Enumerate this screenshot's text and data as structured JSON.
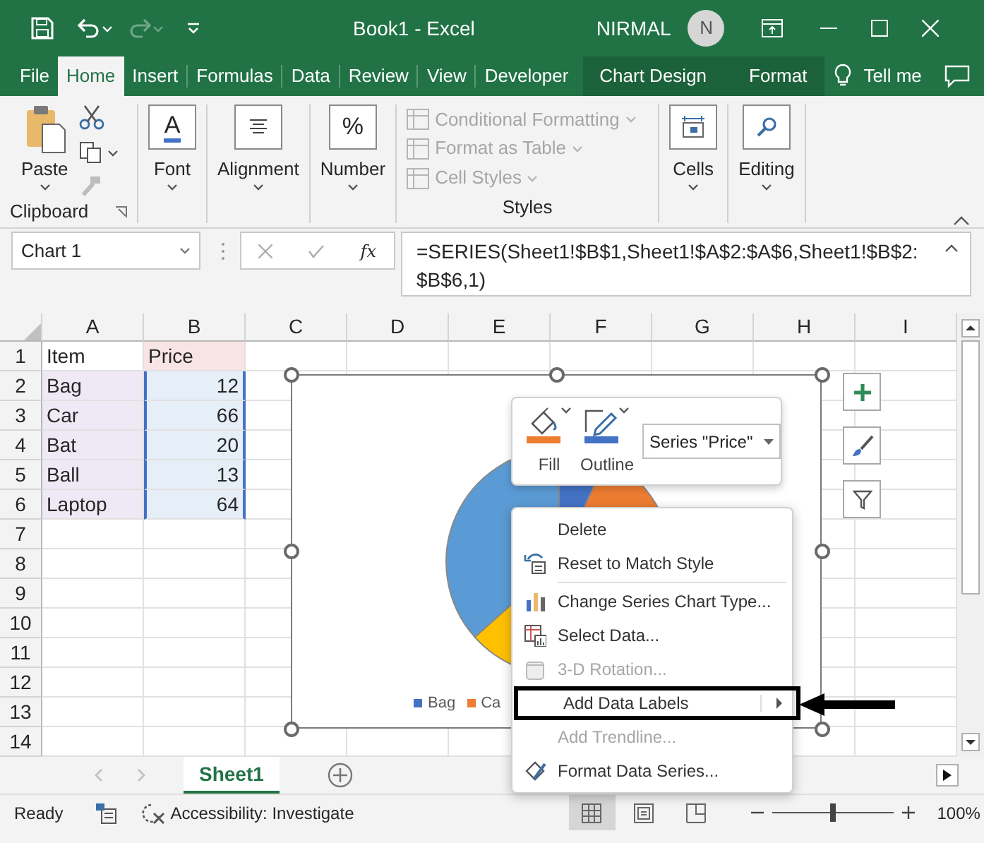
{
  "title_bar": {
    "title": "Book1  -  Excel",
    "user": "NIRMAL",
    "avatar_initial": "N"
  },
  "tabs": [
    {
      "label": "File",
      "selected": false,
      "kind": "plain"
    },
    {
      "label": "Home",
      "selected": true,
      "kind": "plain"
    },
    {
      "label": "Insert",
      "selected": false,
      "kind": "plain"
    },
    {
      "label": "Formulas",
      "selected": false,
      "kind": "plain"
    },
    {
      "label": "Data",
      "selected": false,
      "kind": "plain"
    },
    {
      "label": "Review",
      "selected": false,
      "kind": "plain"
    },
    {
      "label": "View",
      "selected": false,
      "kind": "plain"
    },
    {
      "label": "Developer",
      "selected": false,
      "kind": "plain"
    },
    {
      "label": "Chart Design",
      "selected": false,
      "kind": "contextual"
    },
    {
      "label": "Format",
      "selected": false,
      "kind": "contextual"
    }
  ],
  "tell_me": "Tell me",
  "ribbon": {
    "clipboard": {
      "paste": "Paste",
      "label": "Clipboard"
    },
    "big_buttons": [
      {
        "label": "Font",
        "glyph": "A"
      },
      {
        "label": "Alignment"
      },
      {
        "label": "Number",
        "glyph": "%"
      }
    ],
    "styles": {
      "label": "Styles",
      "items": [
        {
          "label": "Conditional Formatting",
          "disabled": true
        },
        {
          "label": "Format as Table",
          "disabled": true
        },
        {
          "label": "Cell Styles",
          "disabled": true
        }
      ]
    },
    "end_buttons": [
      {
        "label": "Cells"
      },
      {
        "label": "Editing"
      }
    ]
  },
  "formula_bar": {
    "name_box": "Chart 1",
    "fx": "fx",
    "formula": "=SERIES(Sheet1!$B$1,Sheet1!$A$2:$A$6,Sheet1!$B$2:$B$6,1)"
  },
  "columns": [
    "A",
    "B",
    "C",
    "D",
    "E",
    "F",
    "G",
    "H",
    "I"
  ],
  "rows": [
    {
      "number": "1",
      "cells": [
        {
          "text": "Item",
          "kind": "plain"
        },
        {
          "text": "Price",
          "kind": "series-name"
        }
      ]
    },
    {
      "number": "2",
      "cells": [
        {
          "text": "Bag",
          "kind": "category"
        },
        {
          "text": "12",
          "kind": "value"
        }
      ]
    },
    {
      "number": "3",
      "cells": [
        {
          "text": "Car",
          "kind": "category"
        },
        {
          "text": "66",
          "kind": "value"
        }
      ]
    },
    {
      "number": "4",
      "cells": [
        {
          "text": "Bat",
          "kind": "category"
        },
        {
          "text": "20",
          "kind": "value"
        }
      ]
    },
    {
      "number": "5",
      "cells": [
        {
          "text": "Ball",
          "kind": "category"
        },
        {
          "text": "13",
          "kind": "value"
        }
      ]
    },
    {
      "number": "6",
      "cells": [
        {
          "text": "Laptop",
          "kind": "category"
        },
        {
          "text": "64",
          "kind": "value"
        }
      ]
    },
    {
      "number": "7"
    },
    {
      "number": "8"
    },
    {
      "number": "9"
    },
    {
      "number": "10"
    },
    {
      "number": "11"
    },
    {
      "number": "12"
    },
    {
      "number": "13"
    },
    {
      "number": "14"
    }
  ],
  "chart": {
    "legend": [
      {
        "label": "Bag",
        "color": "#4472c4"
      },
      {
        "label": "Ca",
        "color": "#ed7d31"
      }
    ]
  },
  "format_toolbar": {
    "fill": "Fill",
    "outline": "Outline",
    "series": "Series \"Price\""
  },
  "context_menu": [
    {
      "kind": "item",
      "label": "Delete",
      "disabled": false,
      "highlighted": false
    },
    {
      "kind": "item",
      "label": "Reset to Match Style",
      "disabled": false,
      "highlighted": false
    },
    {
      "kind": "separator"
    },
    {
      "kind": "item",
      "label": "Change Series Chart Type...",
      "disabled": false,
      "highlighted": false
    },
    {
      "kind": "item",
      "label": "Select Data...",
      "disabled": false,
      "highlighted": false
    },
    {
      "kind": "item",
      "label": "3-D Rotation...",
      "disabled": true,
      "highlighted": false
    },
    {
      "kind": "submenu",
      "label": "Add Data Labels",
      "disabled": false,
      "highlighted": true
    },
    {
      "kind": "item",
      "label": "Add Trendline...",
      "disabled": true,
      "highlighted": false
    },
    {
      "kind": "item",
      "label": "Format Data Series...",
      "disabled": false,
      "highlighted": false
    }
  ],
  "sheet_tabs": [
    {
      "label": "Sheet1",
      "selected": true
    }
  ],
  "status_bar": {
    "ready": "Ready",
    "accessibility": "Accessibility: Investigate",
    "views": [
      {
        "kind": "normal",
        "selected": true
      },
      {
        "kind": "page-layout",
        "selected": false
      },
      {
        "kind": "page-break",
        "selected": false
      }
    ],
    "zoom_slider": {
      "level": 0.5
    },
    "zoom": "100%"
  }
}
